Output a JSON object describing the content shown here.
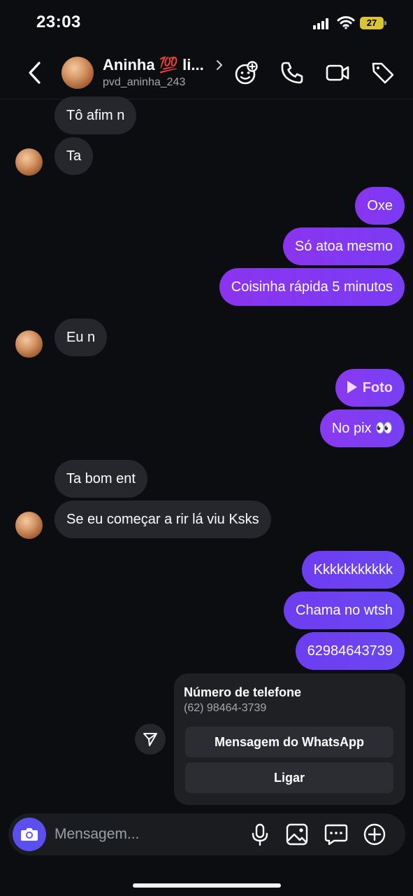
{
  "status_bar": {
    "time": "23:03",
    "battery": "27"
  },
  "header": {
    "name": "Aninha 💯 li...",
    "username": "pvd_aninha_243",
    "icons": [
      "back-chevron-icon",
      "avatar",
      "chevron-right-icon",
      "sticker-add-icon",
      "phone-icon",
      "video-icon",
      "tag-icon"
    ]
  },
  "messages": [
    {
      "side": "in",
      "text": "Tô afim n"
    },
    {
      "side": "in",
      "text": "Ta"
    },
    {
      "side": "out",
      "text": "Oxe"
    },
    {
      "side": "out",
      "text": "Só atoa mesmo"
    },
    {
      "side": "out",
      "text": "Coisinha rápida 5 minutos"
    },
    {
      "side": "in",
      "text": "Eu n"
    },
    {
      "side": "out",
      "text": "Foto",
      "type": "photo"
    },
    {
      "side": "out",
      "text": "No pix 👀"
    },
    {
      "side": "in",
      "text": "Ta bom ent"
    },
    {
      "side": "in",
      "text": "Se eu começar a rir lá viu Ksks"
    },
    {
      "side": "out",
      "text": "Kkkkkkkkkkk"
    },
    {
      "side": "out",
      "text": "Chama no wtsh"
    },
    {
      "side": "out",
      "text": "62984643739"
    }
  ],
  "phone_card": {
    "title": "Número de telefone",
    "number": "(62) 98464-3739",
    "whatsapp_button": "Mensagem do WhatsApp",
    "call_button": "Ligar"
  },
  "composer": {
    "placeholder": "Mensagem...",
    "icons": [
      "camera-icon",
      "microphone-icon",
      "gallery-icon",
      "chat-bubble-icon",
      "plus-circle-icon"
    ]
  },
  "colors": {
    "background": "#0c0d10",
    "incoming_bubble": "#26272c",
    "outgoing_bubble": "#8b34f0",
    "outgoing_bubble_late": "#6f3df2",
    "camera_button": "#5c4ff0",
    "card": "#1f2024"
  }
}
